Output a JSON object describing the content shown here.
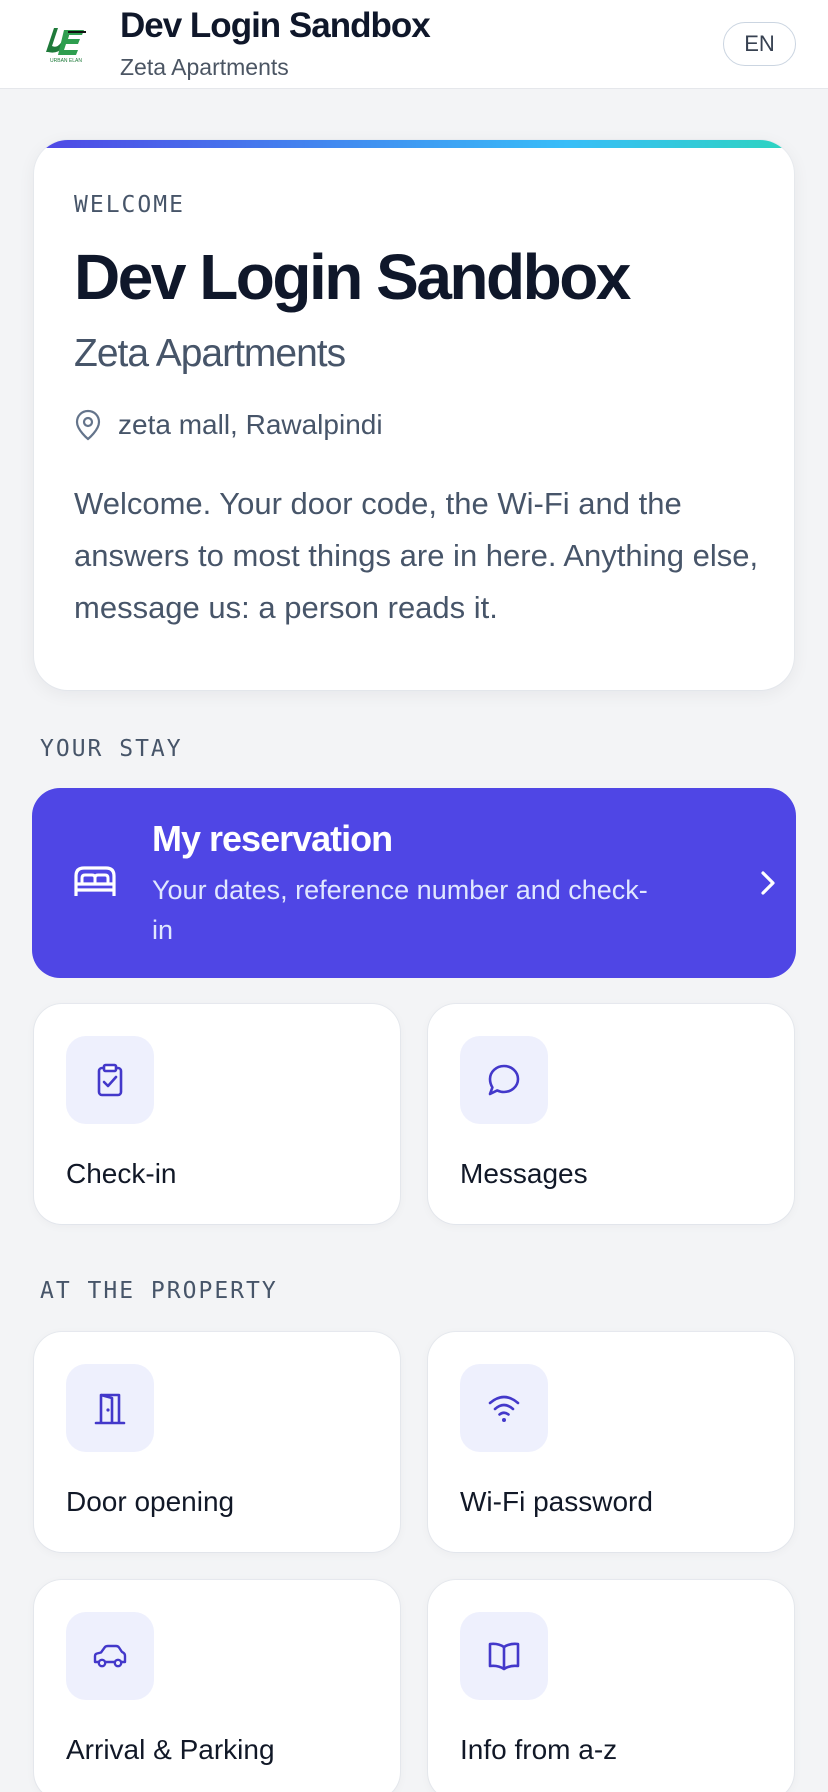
{
  "header": {
    "title": "Dev Login Sandbox",
    "subtitle": "Zeta Apartments",
    "logo_text": "URBAN ELAN",
    "language": "EN"
  },
  "welcome": {
    "eyebrow": "WELCOME",
    "title": "Dev Login Sandbox",
    "subtitle": "Zeta Apartments",
    "location": "zeta mall, Rawalpindi",
    "body": "Welcome. Your door code, the Wi-Fi and the answers to most things are in here. Anything else, message us: a person reads it."
  },
  "sections": {
    "your_stay": "YOUR STAY",
    "at_property": "AT THE PROPERTY"
  },
  "reservation": {
    "title": "My reservation",
    "subtitle": "Your dates, reference number and check-in"
  },
  "tiles": {
    "checkin": "Check-in",
    "messages": "Messages",
    "door": "Door opening",
    "wifi": "Wi-Fi password",
    "parking": "Arrival & Parking",
    "info": "Info from a-z"
  },
  "colors": {
    "accent": "#4f46e5",
    "icon_bg": "#eef0fd",
    "background": "#f3f4f6"
  }
}
